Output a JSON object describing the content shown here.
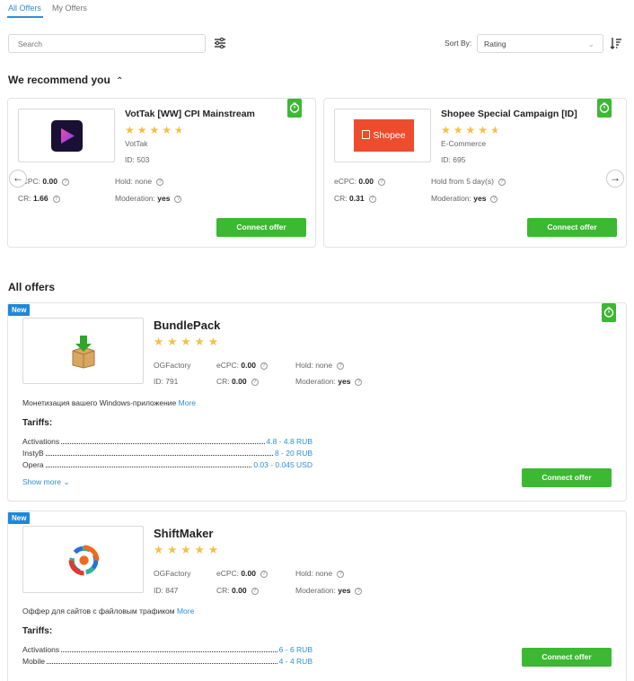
{
  "tabs": [
    {
      "label": "All Offers"
    },
    {
      "label": "My Offers"
    }
  ],
  "search": {
    "placeholder": "Search"
  },
  "sort": {
    "label": "Sort By:",
    "value": "Rating"
  },
  "recommended": {
    "title": "We recommend you",
    "cards": [
      {
        "name": "VotTak [WW] CPI Mainstream",
        "rating": 4.5,
        "category": "VotTak",
        "id": "ID: 503",
        "ecpc_label": "eCPC:",
        "ecpc": "0.00",
        "cr_label": "CR:",
        "cr": "1.66",
        "hold": "Hold: none",
        "moderation_label": "Moderation:",
        "moderation": "yes",
        "button": "Connect offer"
      },
      {
        "name": "Shopee Special Campaign [ID]",
        "rating": 4.5,
        "logo_text": "Shopee",
        "category": "E-Commerce",
        "id": "ID: 695",
        "ecpc_label": "eCPC:",
        "ecpc": "0.00",
        "cr_label": "CR:",
        "cr": "0.31",
        "hold": "Hold from 5 day(s)",
        "moderation_label": "Moderation:",
        "moderation": "yes",
        "button": "Connect offer"
      }
    ]
  },
  "all_offers": {
    "title": "All offers",
    "cards": [
      {
        "badge": "New",
        "name": "BundlePack",
        "rating": 5,
        "advertiser": "OGFactory",
        "id": "ID: 791",
        "ecpc_label": "eCPC:",
        "ecpc": "0.00",
        "cr_label": "CR:",
        "cr": "0.00",
        "hold": "Hold: none",
        "moderation_label": "Moderation:",
        "moderation": "yes",
        "description": "Монетизация вашего Windows-приложение",
        "more": "More",
        "tariffs_title": "Tariffs:",
        "tariffs": [
          {
            "name": "Activations",
            "value": "4.8 - 4.8 RUB"
          },
          {
            "name": "InstyB",
            "value": "8 - 20 RUB"
          },
          {
            "name": "Opera",
            "value": "0.03 - 0.045 USD"
          }
        ],
        "show_more": "Show more",
        "button": "Connect offer"
      },
      {
        "badge": "New",
        "name": "ShiftMaker",
        "rating": 5,
        "advertiser": "OGFactory",
        "id": "ID: 847",
        "ecpc_label": "eCPC:",
        "ecpc": "0.00",
        "cr_label": "CR:",
        "cr": "0.00",
        "hold": "Hold: none",
        "moderation_label": "Moderation:",
        "moderation": "yes",
        "description": "Оффер для сайтов с файловым трафиком",
        "more": "More",
        "tariffs_title": "Tariffs:",
        "tariffs": [
          {
            "name": "Activations",
            "value": "6 - 6 RUB"
          },
          {
            "name": "Mobile",
            "value": "4 - 4 RUB"
          }
        ],
        "button": "Connect offer"
      }
    ]
  },
  "colors": {
    "accent": "#2b8fd6",
    "button": "#3cb832",
    "star": "#f5c043",
    "badge": "#1e88d9"
  }
}
